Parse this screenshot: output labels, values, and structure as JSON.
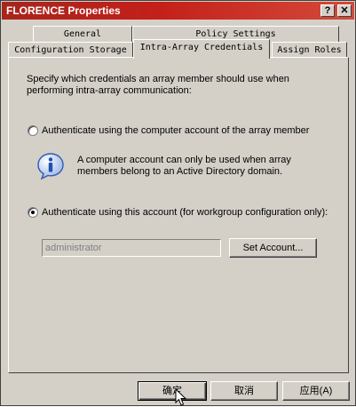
{
  "window": {
    "title": "FLORENCE Properties",
    "help_glyph": "?",
    "close_glyph": "✕"
  },
  "tabs": {
    "row_back": [
      "General",
      "Policy Settings"
    ],
    "row_front": [
      "Configuration Storage",
      "Intra-Array Credentials",
      "Assign Roles"
    ],
    "active": "Intra-Array Credentials"
  },
  "panel": {
    "description_line1": "Specify which credentials an array member should use when",
    "description_line2": "performing intra-array communication:",
    "option_computer_account": "Authenticate using the computer account of the array member",
    "info_line1": "A computer account can only be used when array",
    "info_line2": "members belong to an Active Directory domain.",
    "info_icon": "information-icon",
    "option_this_account": "Authenticate using this account (for workgroup configuration only):",
    "selected_option": "this_account",
    "account_value": "administrator",
    "set_account_label": "Set Account..."
  },
  "footer": {
    "ok_label": "确定",
    "cancel_label": "取消",
    "apply_label": "应用(A)"
  }
}
